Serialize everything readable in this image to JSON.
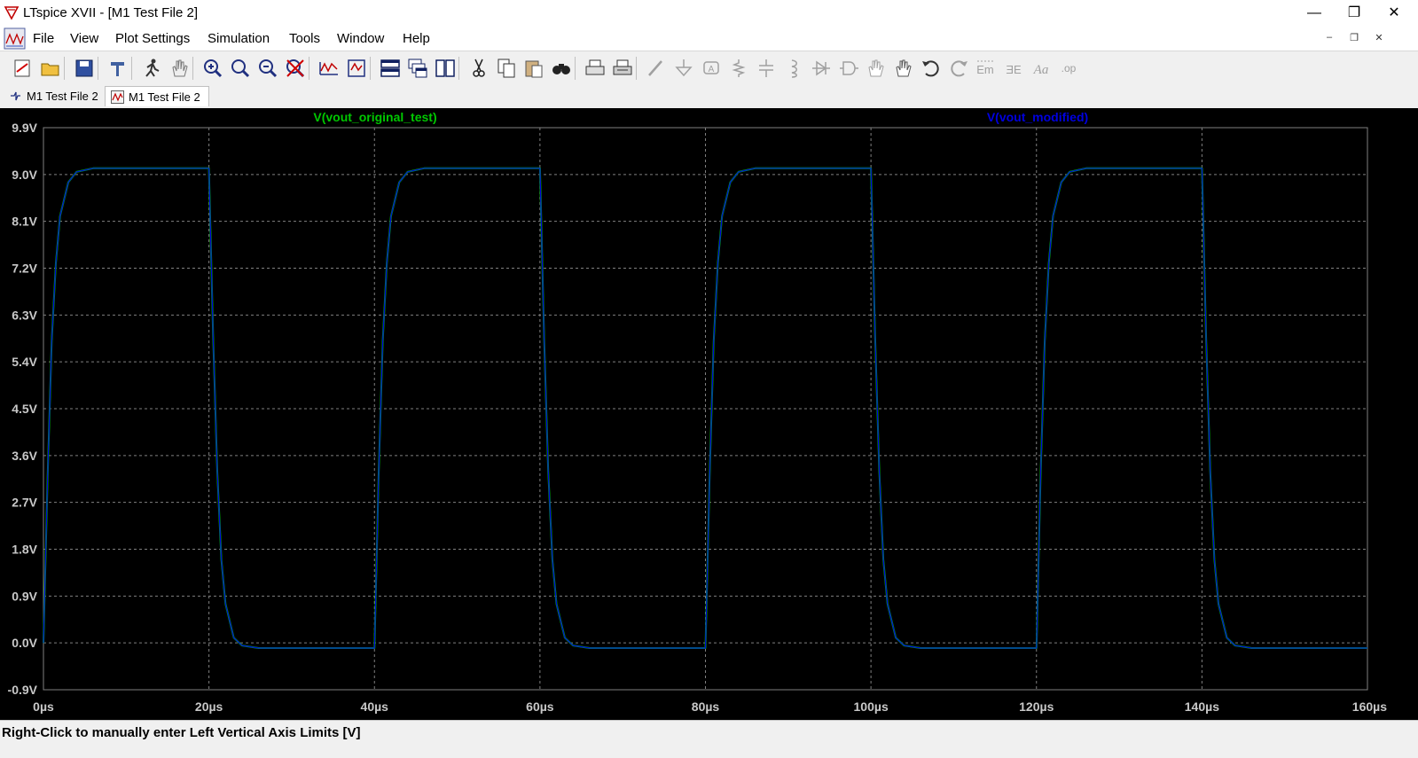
{
  "window": {
    "title": "LTspice XVII - [M1 Test File 2]",
    "minimize_glyph": "—",
    "maximize_glyph": "❐",
    "close_glyph": "✕"
  },
  "menu": {
    "items": [
      {
        "label": "File"
      },
      {
        "label": "View"
      },
      {
        "label": "Plot Settings"
      },
      {
        "label": "Simulation"
      },
      {
        "label": "Tools"
      },
      {
        "label": "Window"
      },
      {
        "label": "Help"
      }
    ],
    "mdi_minimize": "–",
    "mdi_restore": "❐",
    "mdi_close": "✕"
  },
  "toolbar": {
    "icons": [
      "open-icon",
      "folder-icon",
      "save-icon",
      "hammer-control-panel-icon",
      "run-icon",
      "pan-hand-icon",
      "zoom-in-icon",
      "zoom-full-icon",
      "zoom-out-icon",
      "zoom-cancel-icon",
      "autorange-icon",
      "mark-unconnected-icon",
      "tile-horizontal-icon",
      "cascade-icon",
      "tile-vertical-icon",
      "cut-icon",
      "copy-icon",
      "paste-icon",
      "find-icon",
      "print-setup-icon",
      "print-icon",
      "wire-icon",
      "ground-icon",
      "label-icon",
      "resistor-icon",
      "capacitor-icon",
      "inductor-icon",
      "diode-icon",
      "component-icon",
      "move-icon",
      "drag-icon",
      "undo-icon",
      "redo-icon",
      "rotate-icon",
      "mirror-icon",
      "text-icon",
      "spice-directive-icon"
    ]
  },
  "tabs": [
    {
      "label": "M1 Test File 2",
      "type": "schematic",
      "active": false
    },
    {
      "label": "M1 Test File 2",
      "type": "waveform",
      "active": true
    }
  ],
  "plot": {
    "traces": [
      {
        "label": "V(vout_original_test)",
        "color": "#00c800"
      },
      {
        "label": "V(vout_modified)",
        "color": "#0000e0"
      }
    ],
    "background": "#000000",
    "grid_color": "#808080",
    "axis_text_color": "#c8c8c8"
  },
  "chart_data": {
    "type": "line",
    "title": "",
    "xlabel": "",
    "ylabel": "",
    "x_unit": "µs",
    "y_unit": "V",
    "xlim": [
      0,
      160
    ],
    "ylim": [
      -0.9,
      9.9
    ],
    "x_ticks": [
      "0µs",
      "20µs",
      "40µs",
      "60µs",
      "80µs",
      "100µs",
      "120µs",
      "140µs",
      "160µs"
    ],
    "y_ticks": [
      "9.9V",
      "9.0V",
      "8.1V",
      "7.2V",
      "6.3V",
      "5.4V",
      "4.5V",
      "3.6V",
      "2.7V",
      "1.8V",
      "0.9V",
      "0.0V",
      "-0.9V"
    ],
    "grid": true,
    "series": [
      {
        "name": "V(vout_original_test)",
        "color": "#00c800",
        "x": [
          0,
          0.5,
          1,
          1.5,
          2,
          3,
          4,
          6,
          20,
          20.5,
          21,
          21.5,
          22,
          23,
          24,
          26,
          40,
          40.5,
          41,
          41.5,
          42,
          43,
          44,
          46,
          60,
          60.5,
          61,
          61.5,
          62,
          63,
          64,
          66,
          80,
          80.5,
          81,
          81.5,
          82,
          83,
          84,
          86,
          100,
          100.5,
          101,
          101.5,
          102,
          103,
          104,
          106,
          120,
          120.5,
          121,
          121.5,
          122,
          123,
          124,
          126,
          140,
          140.5,
          141,
          141.5,
          142,
          143,
          144,
          146,
          160
        ],
        "values": [
          0,
          3.2,
          5.8,
          7.3,
          8.2,
          8.85,
          9.05,
          9.12,
          9.12,
          5.9,
          3.3,
          1.6,
          0.75,
          0.1,
          -0.05,
          -0.1,
          -0.1,
          3.2,
          5.8,
          7.3,
          8.2,
          8.85,
          9.05,
          9.12,
          9.12,
          5.9,
          3.3,
          1.6,
          0.75,
          0.1,
          -0.05,
          -0.1,
          -0.1,
          3.2,
          5.8,
          7.3,
          8.2,
          8.85,
          9.05,
          9.12,
          9.12,
          5.9,
          3.3,
          1.6,
          0.75,
          0.1,
          -0.05,
          -0.1,
          -0.1,
          3.2,
          5.8,
          7.3,
          8.2,
          8.85,
          9.05,
          9.12,
          9.12,
          5.9,
          3.3,
          1.6,
          0.75,
          0.1,
          -0.05,
          -0.1,
          -0.1
        ]
      },
      {
        "name": "V(vout_modified)",
        "color": "#0000e0",
        "x": [
          0,
          0.5,
          1,
          1.5,
          2,
          3,
          4,
          6,
          20,
          20.5,
          21,
          21.5,
          22,
          23,
          24,
          26,
          40,
          40.5,
          41,
          41.5,
          42,
          43,
          44,
          46,
          60,
          60.5,
          61,
          61.5,
          62,
          63,
          64,
          66,
          80,
          80.5,
          81,
          81.5,
          82,
          83,
          84,
          86,
          100,
          100.5,
          101,
          101.5,
          102,
          103,
          104,
          106,
          120,
          120.5,
          121,
          121.5,
          122,
          123,
          124,
          126,
          140,
          140.5,
          141,
          141.5,
          142,
          143,
          144,
          146,
          160
        ],
        "values": [
          0,
          3.2,
          5.8,
          7.3,
          8.2,
          8.85,
          9.05,
          9.12,
          9.12,
          5.9,
          3.3,
          1.6,
          0.75,
          0.1,
          -0.05,
          -0.1,
          -0.1,
          3.2,
          5.8,
          7.3,
          8.2,
          8.85,
          9.05,
          9.12,
          9.12,
          5.9,
          3.3,
          1.6,
          0.75,
          0.1,
          -0.05,
          -0.1,
          -0.1,
          3.2,
          5.8,
          7.3,
          8.2,
          8.85,
          9.05,
          9.12,
          9.12,
          5.9,
          3.3,
          1.6,
          0.75,
          0.1,
          -0.05,
          -0.1,
          -0.1,
          3.2,
          5.8,
          7.3,
          8.2,
          8.85,
          9.05,
          9.12,
          9.12,
          5.9,
          3.3,
          1.6,
          0.75,
          0.1,
          -0.05,
          -0.1,
          -0.1
        ]
      }
    ]
  },
  "status": {
    "text": "Right-Click to manually enter Left Vertical Axis Limits [V]"
  }
}
